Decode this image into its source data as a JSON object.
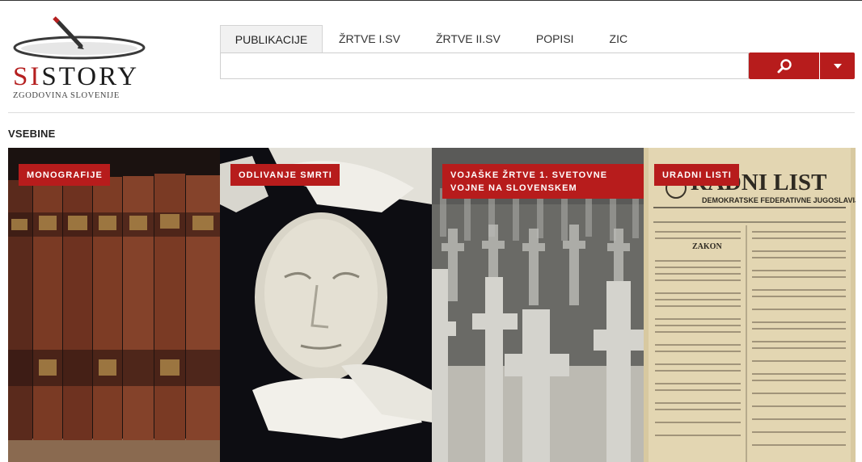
{
  "logo": {
    "brand_red": "SI",
    "brand_dark": "STORY",
    "subtitle": "ZGODOVINA SLOVENIJE"
  },
  "nav": {
    "tabs": [
      {
        "label": "PUBLIKACIJE",
        "active": true
      },
      {
        "label": "ŽRTVE I.SV",
        "active": false
      },
      {
        "label": "ŽRTVE II.SV",
        "active": false
      },
      {
        "label": "POPISI",
        "active": false
      },
      {
        "label": "ZIC",
        "active": false
      }
    ]
  },
  "search": {
    "value": "",
    "placeholder": "",
    "button_icon": "search-icon",
    "dropdown_icon": "caret-down-icon"
  },
  "content": {
    "section_title": "VSEBINE",
    "tiles": [
      {
        "label": "MONOGRAFIJE"
      },
      {
        "label": "ODLIVANJE SMRTI"
      },
      {
        "label": "VOJAŠKE ŽRTVE 1. SVETOVNE VOJNE NA SLOVENSKEM"
      },
      {
        "label": "URADNI LISTI",
        "image_text_line1": "RADNI LIST",
        "image_text_line2": "DEMOKRATSKE FEDERATIVNE JUGOSLAVIJE",
        "image_text_heading": "ZAKON"
      }
    ]
  },
  "colors": {
    "accent": "#b71c1c",
    "tab_active_bg": "#f1f1f1",
    "divider": "#dcdcdc"
  }
}
